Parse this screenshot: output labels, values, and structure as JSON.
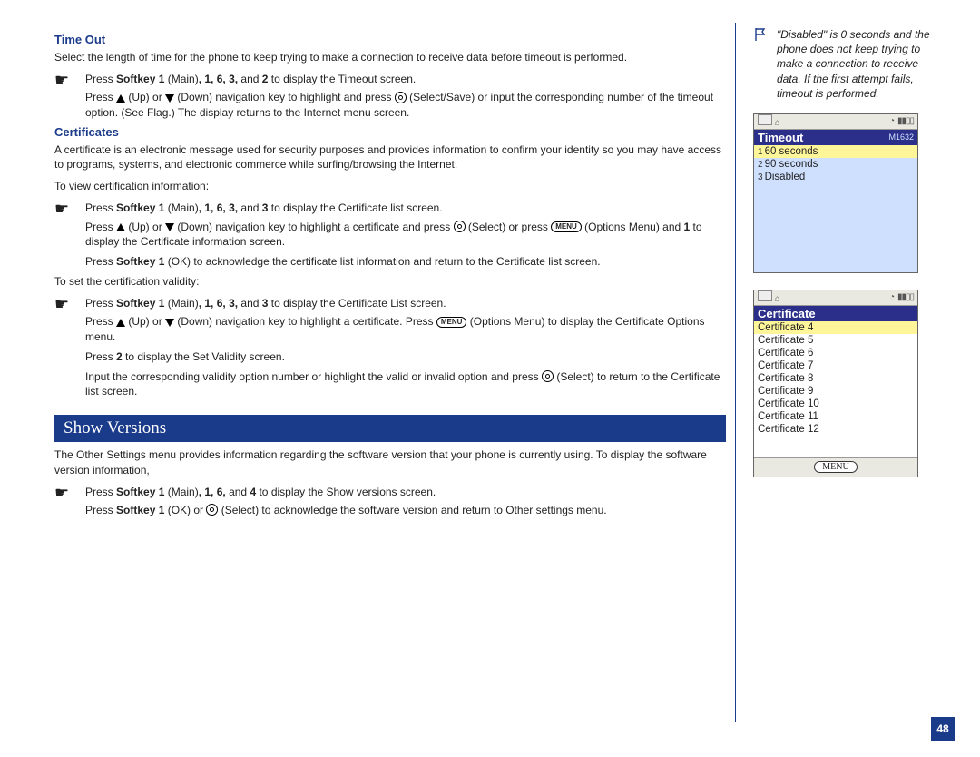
{
  "timeout": {
    "heading": "Time Out",
    "intro": "Select the length of time for the phone to keep trying to make a connection to receive data before timeout is performed.",
    "b1_pre": "Press ",
    "b1_sk": "Softkey 1",
    "b1_mid": " (Main)",
    "b1_keys": ", 1, 6, 3,",
    "b1_post": " and ",
    "b1_last": "2",
    "b1_tail": " to display the Timeout screen.",
    "s1a": "Press ",
    "s1b": " (Up) or ",
    "s1c": " (Down) navigation key to highlight and press ",
    "s1d": " (Select/Save) or input the corresponding number of the timeout option. (See Flag.) The display returns to the Internet menu screen."
  },
  "certs": {
    "heading": "Certificates",
    "intro": "A certificate is an electronic message used for security purposes and provides information to confirm your identity so you may have access to programs, systems, and electronic commerce while surfing/browsing the Internet.",
    "view": "To view certification information:",
    "b1_pre": "Press ",
    "b1_sk": "Softkey 1",
    "b1_mid": " (Main)",
    "b1_keys": ", 1, 6, 3,",
    "b1_post": " and ",
    "b1_last": "3",
    "b1_tail": " to display the Certificate list screen.",
    "s1a": "Press ",
    "s1b": " (Up) or ",
    "s1c": " (Down) navigation key to highlight a certificate and press ",
    "s1d": " (Select) or press ",
    "s1e": " (Options Menu) and ",
    "s1f": "1",
    "s1g": " to display the Certificate information screen.",
    "s2a": "Press ",
    "s2b": "Softkey 1",
    "s2c": " (OK) to acknowledge the certificate list information and return to the Certificate list screen.",
    "validity": "To set the certification validity:",
    "b2_pre": "Press ",
    "b2_sk": "Softkey 1",
    "b2_mid": " (Main)",
    "b2_keys": ", 1, 6, 3,",
    "b2_post": " and ",
    "b2_last": "3",
    "b2_tail": " to display the Certificate List screen.",
    "s3a": "Press ",
    "s3b": " (Up) or ",
    "s3c": " (Down) navigation key to highlight a certificate. Press ",
    "s3d": " (Options Menu) to display the Certificate Options menu.",
    "s4a": "Press ",
    "s4b": "2",
    "s4c": " to display the Set Validity screen.",
    "s5a": "Input the corresponding validity option number or highlight the valid or invalid option and press ",
    "s5b": " (Select) to return to the Certificate list screen."
  },
  "show": {
    "banner": "Show Versions",
    "intro": "The Other Settings menu provides information regarding the software version that your phone is currently using. To display the software version information,",
    "b1_pre": "Press ",
    "b1_sk": "Softkey 1",
    "b1_mid": " (Main)",
    "b1_keys": ", 1, 6,",
    "b1_post": " and ",
    "b1_last": "4",
    "b1_tail": " to display the Show versions screen.",
    "s1a": "Press ",
    "s1b": "Softkey 1",
    "s1c": " (OK) or ",
    "s1d": " (Select) to acknowledge the software version and return to Other settings menu."
  },
  "sidenote": {
    "text": "\"Disabled\" is 0 seconds and the phone does not keep trying to make a connection to receive data. If the first attempt fails, timeout is performed."
  },
  "phone1": {
    "title": "Timeout",
    "code": "M1632",
    "items": [
      {
        "n": "1",
        "t": "60 seconds",
        "hl": true
      },
      {
        "n": "2",
        "t": "90 seconds",
        "hl": false
      },
      {
        "n": "3",
        "t": "Disabled",
        "hl": false
      }
    ]
  },
  "phone2": {
    "title": "Certificate",
    "items": [
      {
        "t": "Certificate 4",
        "hl": true
      },
      {
        "t": "Certificate 5",
        "hl": false
      },
      {
        "t": "Certificate 6",
        "hl": false
      },
      {
        "t": "Certificate 7",
        "hl": false
      },
      {
        "t": "Certificate 8",
        "hl": false
      },
      {
        "t": "Certificate 9",
        "hl": false
      },
      {
        "t": "Certificate 10",
        "hl": false
      },
      {
        "t": "Certificate 11",
        "hl": false
      },
      {
        "t": "Certificate 12",
        "hl": false
      }
    ],
    "soft": "MENU"
  },
  "menu_label": "MENU",
  "page_number": "48"
}
